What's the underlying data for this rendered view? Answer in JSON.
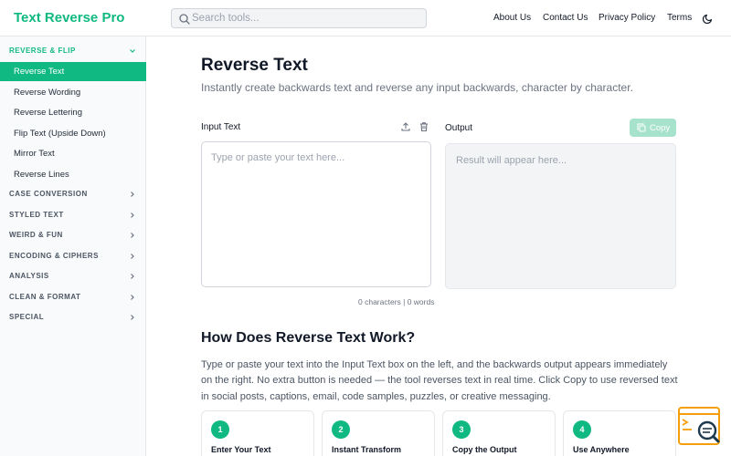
{
  "header": {
    "logo": "Text Reverse Pro",
    "search_placeholder": "Search tools...",
    "nav": [
      "About Us",
      "Contact Us",
      "Privacy Policy",
      "Terms"
    ]
  },
  "sidebar": {
    "open_category": "REVERSE & FLIP",
    "tools": [
      "Reverse Text",
      "Reverse Wording",
      "Reverse Lettering",
      "Flip Text (Upside Down)",
      "Mirror Text",
      "Reverse Lines"
    ],
    "active_tool": "Reverse Text",
    "categories": [
      "CASE CONVERSION",
      "STYLED TEXT",
      "WEIRD & FUN",
      "ENCODING & CIPHERS",
      "ANALYSIS",
      "CLEAN & FORMAT",
      "SPECIAL"
    ]
  },
  "main": {
    "title": "Reverse Text",
    "subtitle": "Instantly create backwards text and reverse any input backwards, character by character.",
    "input_label": "Input Text",
    "input_placeholder": "Type or paste your text here...",
    "output_label": "Output",
    "output_placeholder": "Result will appear here...",
    "copy_label": "Copy",
    "counter": "0 characters | 0 words",
    "how_title": "How Does Reverse Text Work?",
    "how_text": "Type or paste your text into the Input Text box on the left, and the backwards output appears immediately on the right. No extra button is needed — the tool reverses text in real time. Click Copy to use reversed text in social posts, captions, email, code samples, puzzles, or creative messaging.",
    "steps": [
      {
        "num": "1",
        "title": "Enter Your Text"
      },
      {
        "num": "2",
        "title": "Instant Transform"
      },
      {
        "num": "3",
        "title": "Copy the Output"
      },
      {
        "num": "4",
        "title": "Use Anywhere"
      }
    ]
  },
  "colors": {
    "accent": "#10b981",
    "copy_disabled": "#a7e3cc",
    "widget_orange": "#f59e0b",
    "widget_dark": "#1f3a4d"
  }
}
